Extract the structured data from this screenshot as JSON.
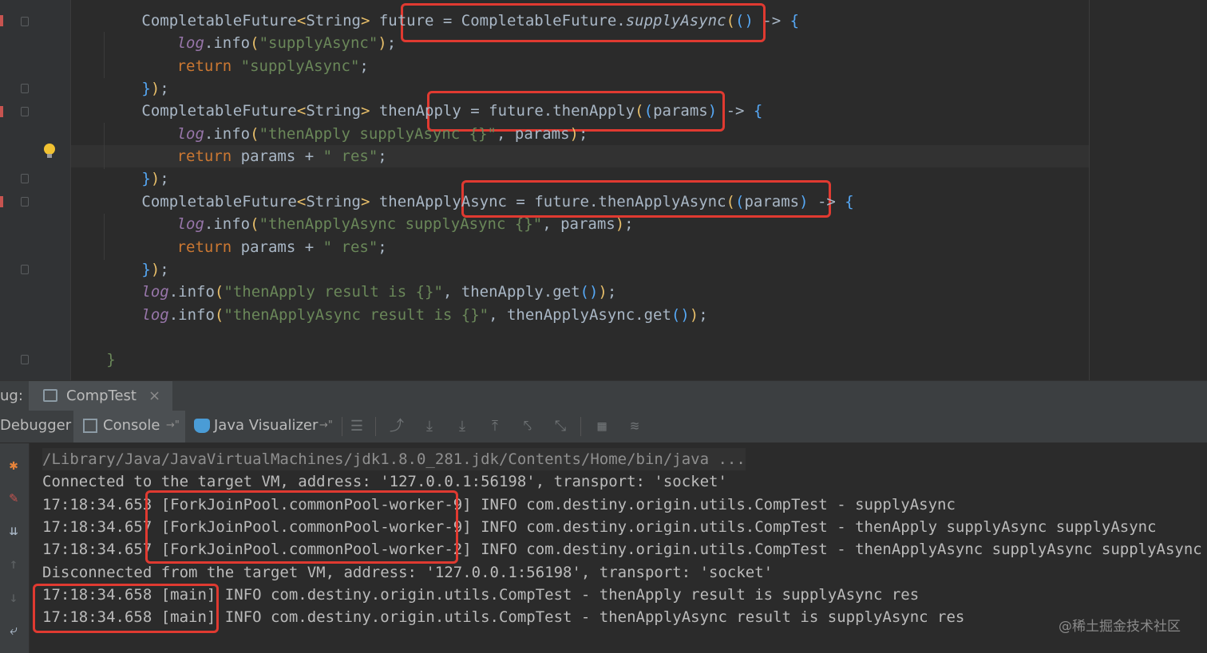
{
  "editor": {
    "lines": [
      {
        "indent": 8,
        "tokens": [
          [
            "cls",
            "CompletableFuture"
          ],
          [
            "p1",
            "<"
          ],
          [
            "cls",
            "String"
          ],
          [
            "p1",
            ">"
          ],
          [
            "cls",
            " future = "
          ],
          [
            "cls",
            "CompletableFuture."
          ],
          [
            "em",
            "supplyAsync"
          ],
          [
            "p1",
            "("
          ],
          [
            "p2",
            "("
          ],
          [
            "p2",
            ")"
          ],
          [
            "cls",
            " -> "
          ],
          [
            "p2",
            "{"
          ]
        ]
      },
      {
        "indent": 12,
        "tokens": [
          [
            "it",
            "log"
          ],
          [
            "cls",
            ".info"
          ],
          [
            "p1",
            "("
          ],
          [
            "str",
            "\"supplyAsync\""
          ],
          [
            "p1",
            ")"
          ],
          [
            "cls",
            ";"
          ]
        ]
      },
      {
        "indent": 12,
        "tokens": [
          [
            "kw",
            "return "
          ],
          [
            "str",
            "\"supplyAsync\""
          ],
          [
            "cls",
            ";"
          ]
        ]
      },
      {
        "indent": 8,
        "tokens": [
          [
            "p2",
            "}"
          ],
          [
            "p1",
            ")"
          ],
          [
            "cls",
            ";"
          ]
        ]
      },
      {
        "indent": 8,
        "tokens": [
          [
            "cls",
            "CompletableFuture"
          ],
          [
            "p1",
            "<"
          ],
          [
            "cls",
            "String"
          ],
          [
            "p1",
            ">"
          ],
          [
            "cls",
            " thenApply = "
          ],
          [
            "cls",
            "future.thenApply"
          ],
          [
            "p1",
            "("
          ],
          [
            "p2",
            "("
          ],
          [
            "cls",
            "params"
          ],
          [
            "p2",
            ")"
          ],
          [
            "cls",
            " -> "
          ],
          [
            "p2",
            "{"
          ]
        ]
      },
      {
        "indent": 12,
        "tokens": [
          [
            "it",
            "log"
          ],
          [
            "cls",
            ".info"
          ],
          [
            "p1",
            "("
          ],
          [
            "str",
            "\"thenApply supplyAsync {}\""
          ],
          [
            "cls",
            ", params"
          ],
          [
            "p1",
            ")"
          ],
          [
            "cls",
            ";"
          ]
        ]
      },
      {
        "indent": 12,
        "tokens": [
          [
            "kw",
            "return "
          ],
          [
            "cls",
            "params + "
          ],
          [
            "str",
            "\" res\""
          ],
          [
            "cls",
            ";"
          ]
        ]
      },
      {
        "indent": 8,
        "tokens": [
          [
            "p2",
            "}"
          ],
          [
            "p1",
            ")"
          ],
          [
            "cls",
            ";"
          ]
        ]
      },
      {
        "indent": 8,
        "tokens": [
          [
            "cls",
            "CompletableFuture"
          ],
          [
            "p1",
            "<"
          ],
          [
            "cls",
            "String"
          ],
          [
            "p1",
            ">"
          ],
          [
            "cls",
            " thenApplyAsync = "
          ],
          [
            "cls",
            "future.thenApplyAsync"
          ],
          [
            "p1",
            "("
          ],
          [
            "p2",
            "("
          ],
          [
            "cls",
            "params"
          ],
          [
            "p2",
            ")"
          ],
          [
            "cls",
            " -> "
          ],
          [
            "p2",
            "{"
          ]
        ]
      },
      {
        "indent": 12,
        "tokens": [
          [
            "it",
            "log"
          ],
          [
            "cls",
            ".info"
          ],
          [
            "p1",
            "("
          ],
          [
            "str",
            "\"thenApplyAsync supplyAsync {}\""
          ],
          [
            "cls",
            ", params"
          ],
          [
            "p1",
            ")"
          ],
          [
            "cls",
            ";"
          ]
        ]
      },
      {
        "indent": 12,
        "tokens": [
          [
            "kw",
            "return "
          ],
          [
            "cls",
            "params + "
          ],
          [
            "str",
            "\" res\""
          ],
          [
            "cls",
            ";"
          ]
        ]
      },
      {
        "indent": 8,
        "tokens": [
          [
            "p2",
            "}"
          ],
          [
            "p1",
            ")"
          ],
          [
            "cls",
            ";"
          ]
        ]
      },
      {
        "indent": 8,
        "tokens": [
          [
            "it",
            "log"
          ],
          [
            "cls",
            ".info"
          ],
          [
            "p1",
            "("
          ],
          [
            "str",
            "\"thenApply result is {}\""
          ],
          [
            "cls",
            ", thenApply.get"
          ],
          [
            "p2",
            "("
          ],
          [
            "p2",
            ")"
          ],
          [
            "p1",
            ")"
          ],
          [
            "cls",
            ";"
          ]
        ]
      },
      {
        "indent": 8,
        "tokens": [
          [
            "it",
            "log"
          ],
          [
            "cls",
            ".info"
          ],
          [
            "p1",
            "("
          ],
          [
            "str",
            "\"thenApplyAsync result is {}\""
          ],
          [
            "cls",
            ", thenApplyAsync.get"
          ],
          [
            "p2",
            "("
          ],
          [
            "p2",
            ")"
          ],
          [
            "p1",
            ")"
          ],
          [
            "cls",
            ";"
          ]
        ]
      },
      {
        "indent": 0,
        "tokens": []
      },
      {
        "indent": 4,
        "tokens": [
          [
            "str",
            "}"
          ]
        ]
      }
    ]
  },
  "tool_window": {
    "debug_label": "ug:",
    "run_tab": "CompTest",
    "close_glyph": "×",
    "tabs": {
      "debugger": "Debugger",
      "console": "Console",
      "java_visualizer": "Java Visualizer",
      "pin_glyph": "→\""
    }
  },
  "console": {
    "lines": [
      {
        "text": "/Library/Java/JavaVirtualMachines/jdk1.8.0_281.jdk/Contents/Home/bin/java ...",
        "kind": "path"
      },
      {
        "text": "Connected to the target VM, address: '127.0.0.1:56198', transport: 'socket'",
        "kind": "normal"
      },
      {
        "text": "17:18:34.653 [ForkJoinPool.commonPool-worker-9] INFO com.destiny.origin.utils.CompTest - supplyAsync",
        "kind": "normal"
      },
      {
        "text": "17:18:34.657 [ForkJoinPool.commonPool-worker-9] INFO com.destiny.origin.utils.CompTest - thenApply supplyAsync supplyAsync",
        "kind": "normal"
      },
      {
        "text": "17:18:34.657 [ForkJoinPool.commonPool-worker-2] INFO com.destiny.origin.utils.CompTest - thenApplyAsync supplyAsync supplyAsync",
        "kind": "normal"
      },
      {
        "text": "Disconnected from the target VM, address: '127.0.0.1:56198', transport: 'socket'",
        "kind": "normal"
      },
      {
        "text": "17:18:34.658 [main] INFO com.destiny.origin.utils.CompTest - thenApply result is supplyAsync res",
        "kind": "normal"
      },
      {
        "text": "17:18:34.658 [main] INFO com.destiny.origin.utils.CompTest - thenApplyAsync result is supplyAsync res",
        "kind": "normal"
      }
    ]
  },
  "watermark": "@稀土掘金技术社区",
  "colors": {
    "highlight": "#e03a31",
    "background": "#2b2b2b",
    "keyword": "#cc7832",
    "string": "#6a8759"
  }
}
